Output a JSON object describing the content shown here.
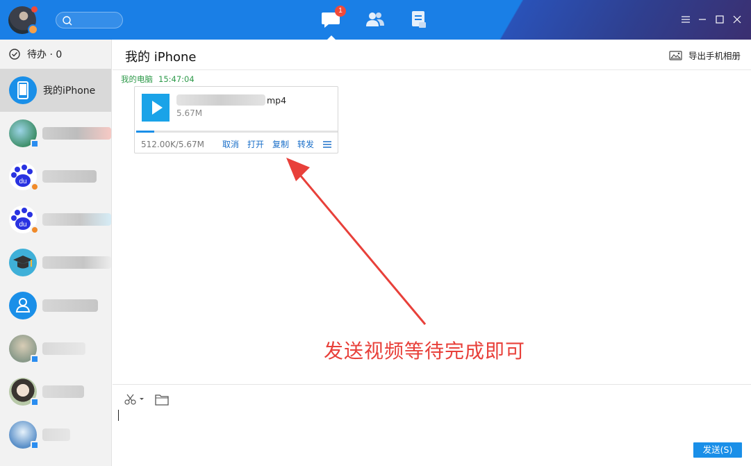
{
  "titlebar": {
    "nav": [
      {
        "icon": "chat-bubble-icon",
        "active": true,
        "badge": "1"
      },
      {
        "icon": "contacts-icon",
        "active": false
      },
      {
        "icon": "document-icon",
        "active": false
      }
    ]
  },
  "sidebar": {
    "todo_label": "待办 · 0",
    "contacts": [
      {
        "name": "我的iPhone",
        "avatar": "iphone-avatar",
        "selected": true
      },
      {
        "name": "",
        "avatar": "photo-avatar",
        "selected": false
      },
      {
        "name": "",
        "avatar": "baidu-du-avatar",
        "selected": false
      },
      {
        "name": "",
        "avatar": "baidu-du-avatar",
        "selected": false
      },
      {
        "name": "",
        "avatar": "graduation-cap-avatar",
        "selected": false
      },
      {
        "name": "",
        "avatar": "group-avatar",
        "selected": false
      },
      {
        "name": "",
        "avatar": "photo-avatar",
        "selected": false
      },
      {
        "name": "",
        "avatar": "photo-avatar",
        "selected": false
      },
      {
        "name": "",
        "avatar": "photo-avatar",
        "selected": false
      }
    ]
  },
  "main": {
    "title": "我的 iPhone",
    "export_label": "导出手机相册",
    "message": {
      "sender": "我的电脑",
      "time": "15:47:04",
      "file_name_tail": "mp4",
      "file_size": "5.67M",
      "progress_text": "512.00K/5.67M",
      "progress_fraction": 0.088,
      "actions": [
        "取消",
        "打开",
        "复制",
        "转发"
      ]
    },
    "annotation": "发送视频等待完成即可",
    "composer": {
      "send_label": "发送(S)"
    }
  },
  "colors": {
    "titlebar": "#1a7fe6",
    "accent": "#1a8fe8",
    "annotation": "#e8403a",
    "timestamp_green": "#2e9a4a"
  }
}
